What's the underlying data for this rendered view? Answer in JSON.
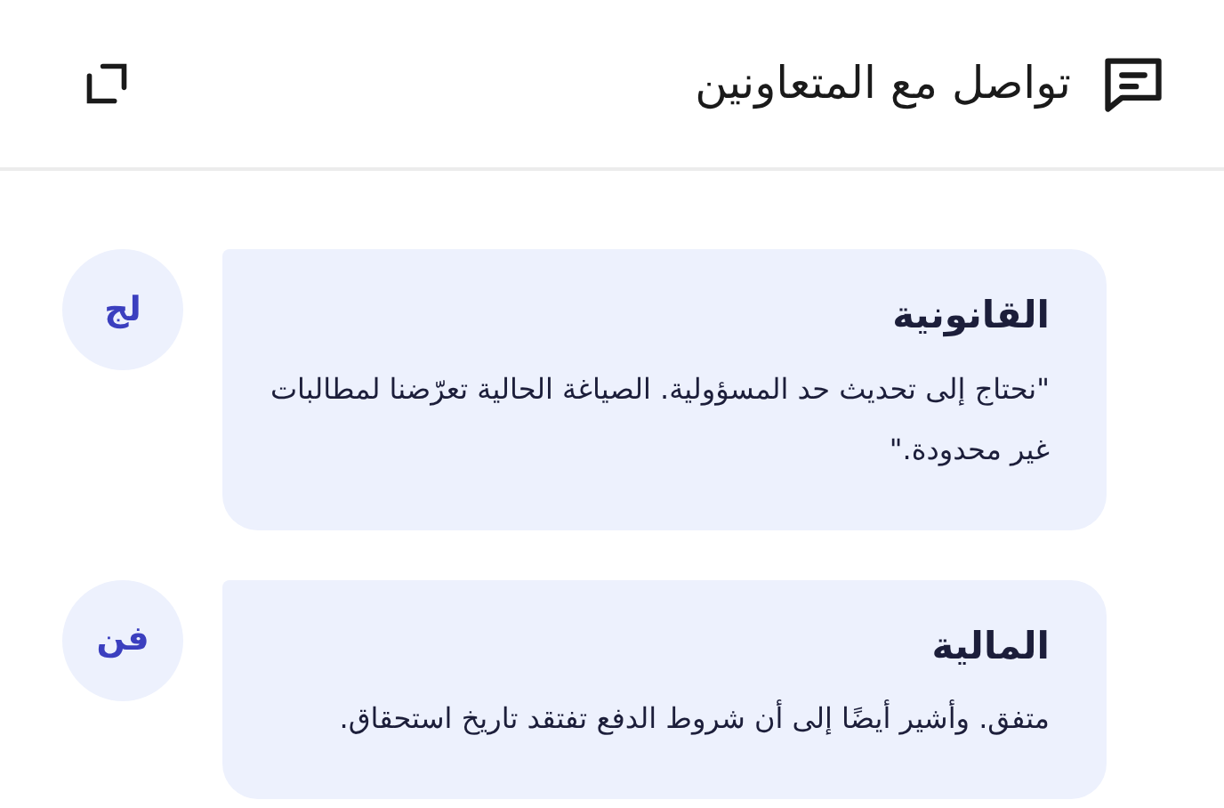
{
  "header": {
    "title": "تواصل مع المتعاونين"
  },
  "messages": [
    {
      "initials": "لج",
      "author": "القانونية",
      "text": "\"نحتاج إلى تحديث حد المسؤولية. الصياغة الحالية تعرّضنا لمطالبات غير محدودة.\""
    },
    {
      "initials": "فن",
      "author": "المالية",
      "text": "متفق. وأشير أيضًا إلى أن شروط الدفع تفتقد تاريخ استحقاق."
    }
  ]
}
